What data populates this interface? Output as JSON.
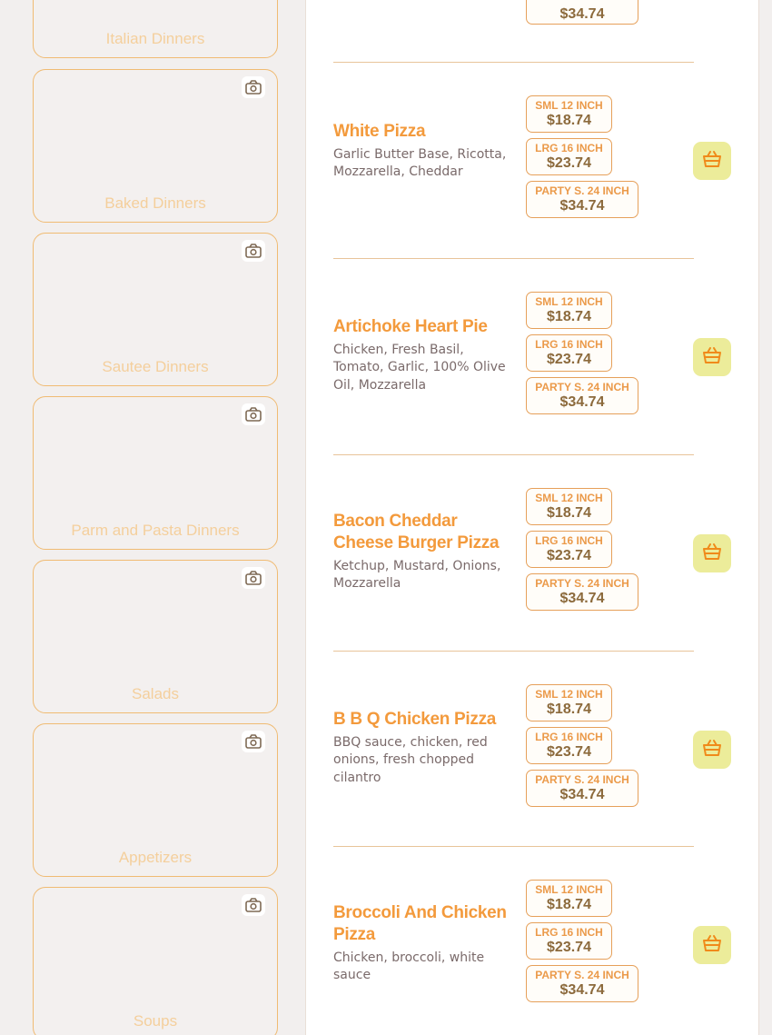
{
  "categories": [
    {
      "name": "Italian Dinners",
      "icon": "camera-icon"
    },
    {
      "name": "Baked Dinners",
      "icon": "camera-icon"
    },
    {
      "name": "Sautee Dinners",
      "icon": "camera-icon"
    },
    {
      "name": "Parm and Pasta Dinners",
      "icon": "camera-icon"
    },
    {
      "name": "Salads",
      "icon": "camera-icon"
    },
    {
      "name": "Appetizers",
      "icon": "camera-icon"
    },
    {
      "name": "Soups",
      "icon": "camera-icon"
    }
  ],
  "top_partial": {
    "party_price": "$34.74"
  },
  "items": [
    {
      "title": "White Pizza",
      "description": "Garlic Butter Base, Ricotta, Mozzarella, Cheddar",
      "prices": [
        {
          "size": "SML 12 INCH",
          "price": "$18.74"
        },
        {
          "size": "LRG 16 INCH",
          "price": "$23.74"
        },
        {
          "size": "PARTY S. 24 INCH",
          "price": "$34.74"
        }
      ]
    },
    {
      "title": "Artichoke Heart Pie",
      "description": "Chicken, Fresh Basil, Tomato, Garlic, 100% Olive Oil, Mozzarella",
      "prices": [
        {
          "size": "SML 12 INCH",
          "price": "$18.74"
        },
        {
          "size": "LRG 16 INCH",
          "price": "$23.74"
        },
        {
          "size": "PARTY S. 24 INCH",
          "price": "$34.74"
        }
      ]
    },
    {
      "title": "Bacon Cheddar Cheese Burger Pizza",
      "description": "Ketchup, Mustard, Onions, Mozzarella",
      "prices": [
        {
          "size": "SML 12 INCH",
          "price": "$18.74"
        },
        {
          "size": "LRG 16 INCH",
          "price": "$23.74"
        },
        {
          "size": "PARTY S. 24 INCH",
          "price": "$34.74"
        }
      ]
    },
    {
      "title": "B B Q Chicken Pizza",
      "description": "BBQ sauce, chicken, red onions, fresh chopped cilantro",
      "prices": [
        {
          "size": "SML 12 INCH",
          "price": "$18.74"
        },
        {
          "size": "LRG 16 INCH",
          "price": "$23.74"
        },
        {
          "size": "PARTY S. 24 INCH",
          "price": "$34.74"
        }
      ]
    },
    {
      "title": "Broccoli And Chicken Pizza",
      "description": "Chicken, broccoli, white sauce",
      "prices": [
        {
          "size": "SML 12 INCH",
          "price": "$18.74"
        },
        {
          "size": "LRG 16 INCH",
          "price": "$23.74"
        },
        {
          "size": "PARTY S. 24 INCH",
          "price": "$34.74"
        }
      ]
    }
  ],
  "colors": {
    "accent": "#f39a3c",
    "cart_button": "#ecec9a",
    "cart_icon": "#f08a1a",
    "border": "#f0bb73"
  }
}
